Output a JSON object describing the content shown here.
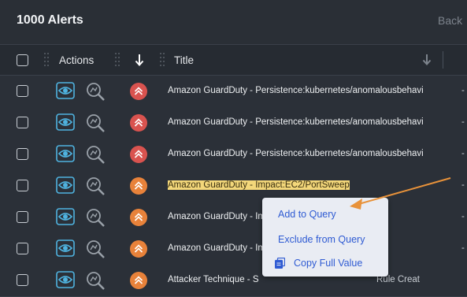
{
  "header": {
    "title": "1000 Alerts",
    "back_label": "Back"
  },
  "columns": {
    "actions": "Actions",
    "title": "Title"
  },
  "rows": [
    {
      "severity": "high",
      "title": "Amazon GuardDuty - Persistence:kubernetes/anomalousbehavi",
      "extra": "-"
    },
    {
      "severity": "high",
      "title": "Amazon GuardDuty - Persistence:kubernetes/anomalousbehavi",
      "extra": "-"
    },
    {
      "severity": "high",
      "title": "Amazon GuardDuty - Persistence:kubernetes/anomalousbehavi",
      "extra": "-"
    },
    {
      "severity": "medium",
      "title": "Amazon GuardDuty - Impact:EC2/PortSweep",
      "extra": "-",
      "highlighted": true
    },
    {
      "severity": "medium",
      "title": "Amazon GuardDuty - Im",
      "extra": "-"
    },
    {
      "severity": "medium",
      "title": "Amazon GuardDuty - Im",
      "extra": "-"
    },
    {
      "severity": "low",
      "title": "Attacker Technique - S",
      "extra": "Rule Creat"
    }
  ],
  "context_menu": {
    "items": [
      "Add to Query",
      "Exclude from Query",
      "Copy Full Value"
    ]
  },
  "colors": {
    "high": "#d9534f",
    "medium": "#e8823a",
    "low": "#e8823a",
    "menu_text": "#2f5bd3",
    "highlight": "#f3d77a",
    "annotation_arrow": "#e8923a"
  },
  "icons": {
    "view": "eye-icon",
    "investigate": "magnifier-icon",
    "severity": "chevron-up-double-icon",
    "copy": "copy-icon",
    "sort": "arrow-down-icon"
  }
}
